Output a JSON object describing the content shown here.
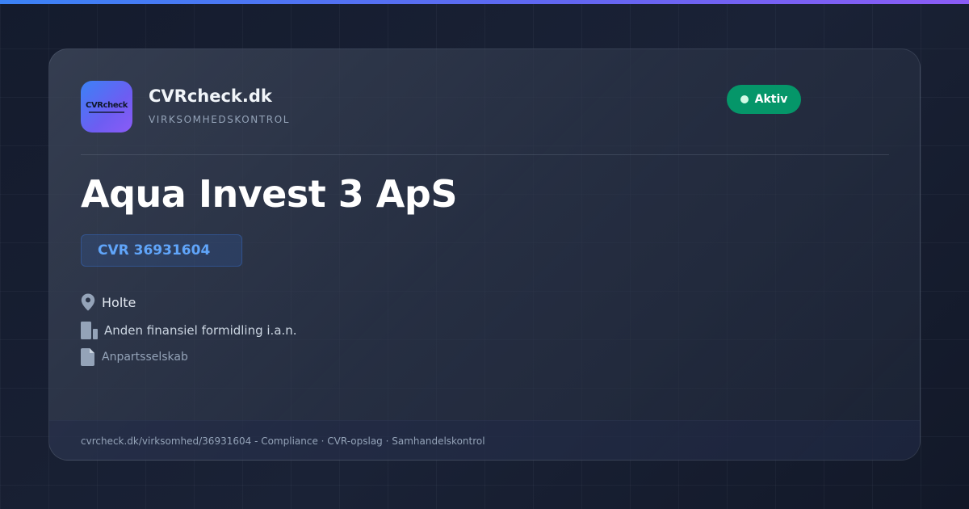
{
  "brand": {
    "logo_text": "CVRcheck",
    "name": "CVRcheck.dk",
    "tagline": "VIRKSOMHEDSKONTROL",
    "accent": "#3b82f6"
  },
  "status": {
    "label": "Aktiv",
    "color": "#059669"
  },
  "company": {
    "name": "Aqua Invest 3 ApS",
    "cvr_label": "CVR 36931604",
    "city": "Holte",
    "industry": "Anden finansiel formidling i.a.n.",
    "company_type": "Anpartsselskab"
  },
  "icons": {
    "city": "map-pin-icon",
    "industry": "building-icon",
    "company_type": "document-icon"
  },
  "footer": {
    "text": "cvrcheck.dk/virksomhed/36931604 - Compliance · CVR-opslag · Samhandelskontrol"
  }
}
